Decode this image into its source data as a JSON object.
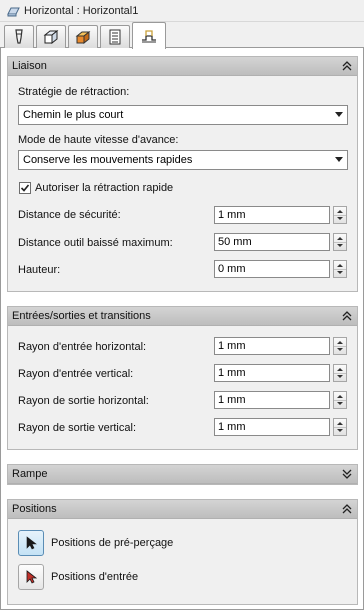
{
  "window": {
    "title": "Horizontal : Horizontal1",
    "icon": "feature-icon"
  },
  "tabs": [
    {
      "icon": "tool-icon",
      "active": false
    },
    {
      "icon": "stock-icon",
      "active": false
    },
    {
      "icon": "heights-icon",
      "active": false
    },
    {
      "icon": "passes-icon",
      "active": false
    },
    {
      "icon": "linking-icon",
      "active": true
    }
  ],
  "liaison": {
    "title": "Liaison",
    "retract_strategy_label": "Stratégie de rétraction:",
    "retract_strategy_value": "Chemin le plus court",
    "high_feed_label": "Mode de haute vitesse d'avance:",
    "high_feed_value": "Conserve les mouvements rapides",
    "rapid_retract_label": "Autoriser la rétraction rapide",
    "rapid_retract_checked": true,
    "safe_distance_label": "Distance de sécurité:",
    "safe_distance_value": "1 mm",
    "max_stay_down_label": "Distance outil baissé maximum:",
    "max_stay_down_value": "50 mm",
    "height_label": "Hauteur:",
    "height_value": "0 mm"
  },
  "leads": {
    "title": "Entrées/sorties et transitions",
    "h_entry_label": "Rayon d'entrée horizontal:",
    "h_entry_value": "1 mm",
    "v_entry_label": "Rayon d'entrée vertical:",
    "v_entry_value": "1 mm",
    "h_exit_label": "Rayon de sortie horizontal:",
    "h_exit_value": "1 mm",
    "v_exit_label": "Rayon de sortie vertical:",
    "v_exit_value": "1 mm"
  },
  "ramp": {
    "title": "Rampe"
  },
  "positions": {
    "title": "Positions",
    "predrill_label": "Positions de pré-perçage",
    "entry_label": "Positions d'entrée"
  },
  "colors": {
    "header_bg": "#c8c8c8",
    "panel_bg": "#f0f0f0",
    "accent": "#5a8db5"
  }
}
